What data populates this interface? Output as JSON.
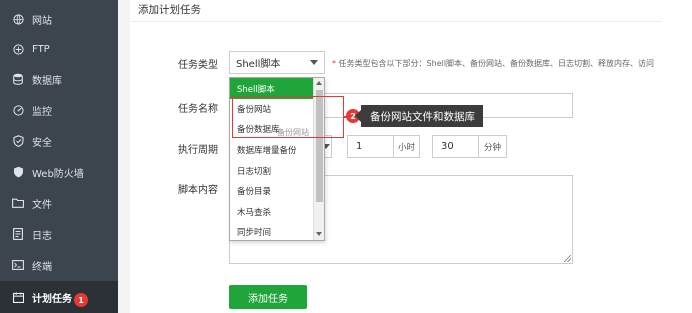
{
  "sidebar": {
    "items": [
      {
        "label": "网站",
        "icon": "globe-icon"
      },
      {
        "label": "FTP",
        "icon": "ftp-icon"
      },
      {
        "label": "数据库",
        "icon": "database-icon"
      },
      {
        "label": "监控",
        "icon": "monitor-icon"
      },
      {
        "label": "安全",
        "icon": "shield-icon"
      },
      {
        "label": "Web防火墙",
        "icon": "firewall-shield-icon"
      },
      {
        "label": "文件",
        "icon": "folder-icon"
      },
      {
        "label": "日志",
        "icon": "log-icon"
      },
      {
        "label": "终端",
        "icon": "terminal-icon"
      },
      {
        "label": "计划任务",
        "icon": "calendar-icon"
      }
    ],
    "active_badge": "1"
  },
  "page": {
    "title": "添加计划任务"
  },
  "form": {
    "task_type_label": "任务类型",
    "task_type_value": "Shell脚本",
    "task_type_hint_star": "*",
    "task_type_hint": "任务类型包含以下部分：Shell脚本、备份网站、备份数据库、日志切割、释放内存、访问",
    "task_name_label": "任务名称",
    "period_label": "执行周期",
    "hour_value": "1",
    "hour_unit": "小时",
    "minute_value": "30",
    "minute_unit": "分钟",
    "script_label": "脚本内容",
    "submit_label": "添加任务"
  },
  "dropdown": {
    "options": [
      "Shell脚本",
      "备份网站",
      "备份数据库",
      "数据库增量备份",
      "日志切割",
      "备份目录",
      "木马查杀",
      "同步时间"
    ],
    "selected_index": 0,
    "ghost_text": "备份网站"
  },
  "annotation": {
    "badge": "2",
    "label": "备份网站文件和数据库"
  },
  "colors": {
    "sidebar_bg": "#3c444d",
    "accent_green": "#20a53a",
    "annotation_red": "#e53935"
  }
}
